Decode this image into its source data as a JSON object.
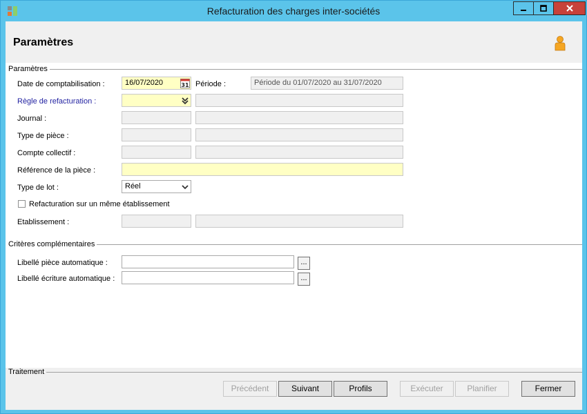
{
  "window": {
    "title": "Refacturation des charges inter-sociétés",
    "minimize_icon": "minimize-icon",
    "maximize_icon": "maximize-icon",
    "close_icon": "close-icon"
  },
  "header": {
    "title": "Paramètres",
    "user_icon": "user-icon"
  },
  "params": {
    "group_label": "Paramètres",
    "date_label": "Date de comptabilisation :",
    "date_value": "16/07/2020",
    "calendar_icon_text": "31",
    "periode_label": "Période :",
    "periode_value": "Période du 01/07/2020 au 31/07/2020",
    "regle_label": "Règle de refacturation :",
    "regle_value": "",
    "journal_label": "Journal :",
    "type_piece_label": "Type de pièce :",
    "compte_label": "Compte collectif :",
    "reference_label": "Référence de la pièce  :",
    "reference_value": "",
    "type_lot_label": "Type de lot :",
    "type_lot_value": "Réel",
    "checkbox_label": "Refacturation sur un même établissement",
    "checkbox_checked": false,
    "etablissement_label": "Etablissement :"
  },
  "criteria": {
    "group_label": "Critères complémentaires",
    "libelle_piece_label": "Libellé pièce automatique :",
    "libelle_piece_value": "",
    "libelle_ecriture_label": "Libellé écriture automatique :",
    "libelle_ecriture_value": "",
    "browse_label": "..."
  },
  "footer": {
    "group_label": "Traitement",
    "precedent": "Précédent",
    "suivant": "Suivant",
    "profils": "Profils",
    "executer": "Exécuter",
    "planifier": "Planifier",
    "fermer": "Fermer"
  }
}
